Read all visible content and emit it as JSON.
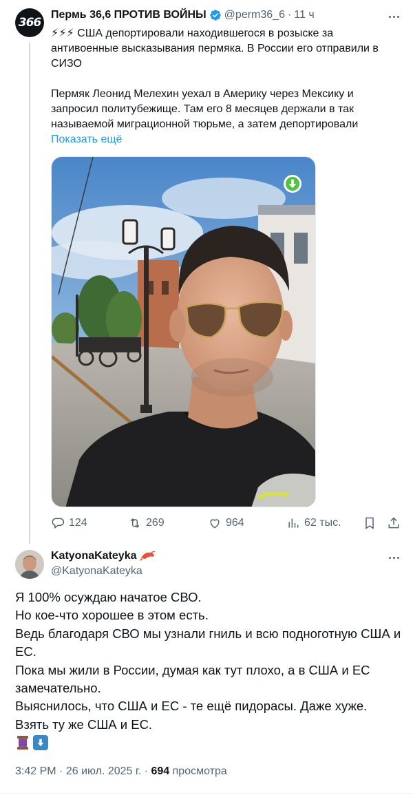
{
  "parent_tweet": {
    "avatar_text": "366",
    "author_name": "Пермь 36,6 ПРОТИВ ВОЙНЫ",
    "handle": "@perm36_6",
    "time_separator": "·",
    "time": "11 ч",
    "text_headline": "⚡⚡⚡ США депортировали находившегося в розыске за антивоенные высказывания пермяка. В России его отправили в СИЗО",
    "text_body": "Пермяк Леонид Мелехин уехал в Америку через Мексику и запросил политубежище. Там его 8 месяцев держали в так называемой миграционной тюрьме, а затем депортировали",
    "show_more": "Показать ещё",
    "stats": {
      "replies": "124",
      "retweets": "269",
      "likes": "964",
      "views": "62 тыс."
    }
  },
  "reply_tweet": {
    "author_name": "KatyonaKateyka",
    "handle": "@KatyonaKateyka",
    "lines": [
      "Я 100% осуждаю начатое СВО.",
      "Но кое-что хорошее в этом есть.",
      "Ведь благодаря СВО мы узнали гниль и всю подноготную США и ЕС.",
      "Пока мы жили в России, думая как тут плохо, а в США и ЕС замечательно.",
      "Выяснилось, что США и ЕС - те ещё пидорасы. Даже хуже.",
      "Взять ту же США и ЕС."
    ],
    "time": "3:42 PM",
    "date": "26 июл. 2025 г.",
    "separator": "·",
    "views_count": "694",
    "views_label": "просмотра"
  },
  "colors": {
    "accent": "#1d9bf0",
    "text": "#0f1419",
    "secondary": "#536471",
    "verified": "#1d9bf0",
    "thread_line": "#cfd9de"
  },
  "icons": {
    "verified": "verified-badge-icon",
    "reply": "reply-icon",
    "retweet": "retweet-icon",
    "like": "heart-icon",
    "views": "views-icon",
    "bookmark": "bookmark-icon",
    "share": "share-icon",
    "more": "more-icon",
    "shrimp": "shrimp-emoji",
    "spool": "spool-emoji",
    "down_arrow": "down-arrow-emoji"
  }
}
